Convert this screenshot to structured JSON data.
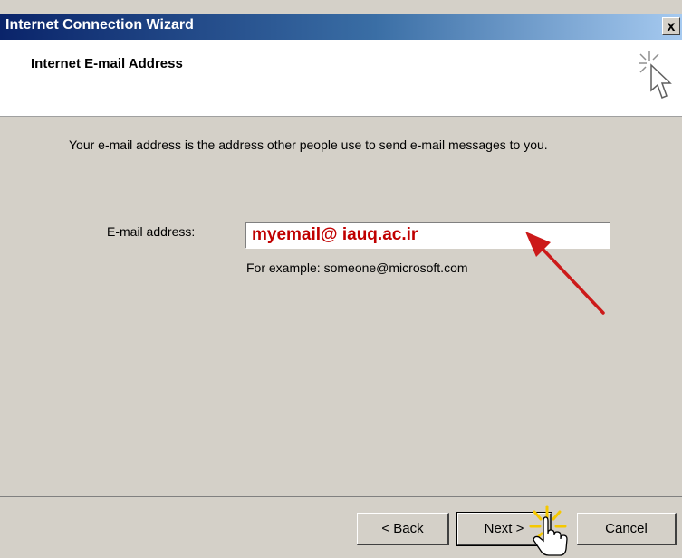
{
  "window": {
    "title": "Internet Connection Wizard",
    "close_label": "x"
  },
  "header": {
    "title": "Internet E-mail Address"
  },
  "body": {
    "description": "Your e-mail address is the address other people use to send e-mail messages to you.",
    "email_label": "E-mail address:",
    "email_value": "myemail@ iauq.ac.ir",
    "example": "For example: someone@microsoft.com"
  },
  "buttons": {
    "back": "< Back",
    "next": "Next >",
    "cancel": "Cancel"
  },
  "colors": {
    "title_gradient_start": "#0a246a",
    "title_gradient_end": "#a6caf0",
    "dialog_face": "#d4d0c8",
    "email_text": "#c00000",
    "annotation_arrow": "#cc1a1a",
    "click_burst": "#f5c800"
  },
  "icons": [
    "wizard-cursor-icon",
    "close-icon",
    "annotation-arrow",
    "hand-pointer-icon",
    "click-burst-icon"
  ]
}
